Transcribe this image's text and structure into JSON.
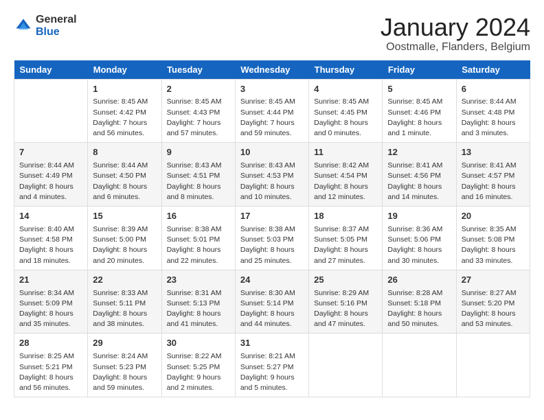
{
  "header": {
    "logo_general": "General",
    "logo_blue": "Blue",
    "month_title": "January 2024",
    "location": "Oostmalle, Flanders, Belgium"
  },
  "days_of_week": [
    "Sunday",
    "Monday",
    "Tuesday",
    "Wednesday",
    "Thursday",
    "Friday",
    "Saturday"
  ],
  "weeks": [
    [
      {
        "day": "",
        "details": ""
      },
      {
        "day": "1",
        "details": "Sunrise: 8:45 AM\nSunset: 4:42 PM\nDaylight: 7 hours\nand 56 minutes."
      },
      {
        "day": "2",
        "details": "Sunrise: 8:45 AM\nSunset: 4:43 PM\nDaylight: 7 hours\nand 57 minutes."
      },
      {
        "day": "3",
        "details": "Sunrise: 8:45 AM\nSunset: 4:44 PM\nDaylight: 7 hours\nand 59 minutes."
      },
      {
        "day": "4",
        "details": "Sunrise: 8:45 AM\nSunset: 4:45 PM\nDaylight: 8 hours\nand 0 minutes."
      },
      {
        "day": "5",
        "details": "Sunrise: 8:45 AM\nSunset: 4:46 PM\nDaylight: 8 hours\nand 1 minute."
      },
      {
        "day": "6",
        "details": "Sunrise: 8:44 AM\nSunset: 4:48 PM\nDaylight: 8 hours\nand 3 minutes."
      }
    ],
    [
      {
        "day": "7",
        "details": "Sunrise: 8:44 AM\nSunset: 4:49 PM\nDaylight: 8 hours\nand 4 minutes."
      },
      {
        "day": "8",
        "details": "Sunrise: 8:44 AM\nSunset: 4:50 PM\nDaylight: 8 hours\nand 6 minutes."
      },
      {
        "day": "9",
        "details": "Sunrise: 8:43 AM\nSunset: 4:51 PM\nDaylight: 8 hours\nand 8 minutes."
      },
      {
        "day": "10",
        "details": "Sunrise: 8:43 AM\nSunset: 4:53 PM\nDaylight: 8 hours\nand 10 minutes."
      },
      {
        "day": "11",
        "details": "Sunrise: 8:42 AM\nSunset: 4:54 PM\nDaylight: 8 hours\nand 12 minutes."
      },
      {
        "day": "12",
        "details": "Sunrise: 8:41 AM\nSunset: 4:56 PM\nDaylight: 8 hours\nand 14 minutes."
      },
      {
        "day": "13",
        "details": "Sunrise: 8:41 AM\nSunset: 4:57 PM\nDaylight: 8 hours\nand 16 minutes."
      }
    ],
    [
      {
        "day": "14",
        "details": "Sunrise: 8:40 AM\nSunset: 4:58 PM\nDaylight: 8 hours\nand 18 minutes."
      },
      {
        "day": "15",
        "details": "Sunrise: 8:39 AM\nSunset: 5:00 PM\nDaylight: 8 hours\nand 20 minutes."
      },
      {
        "day": "16",
        "details": "Sunrise: 8:38 AM\nSunset: 5:01 PM\nDaylight: 8 hours\nand 22 minutes."
      },
      {
        "day": "17",
        "details": "Sunrise: 8:38 AM\nSunset: 5:03 PM\nDaylight: 8 hours\nand 25 minutes."
      },
      {
        "day": "18",
        "details": "Sunrise: 8:37 AM\nSunset: 5:05 PM\nDaylight: 8 hours\nand 27 minutes."
      },
      {
        "day": "19",
        "details": "Sunrise: 8:36 AM\nSunset: 5:06 PM\nDaylight: 8 hours\nand 30 minutes."
      },
      {
        "day": "20",
        "details": "Sunrise: 8:35 AM\nSunset: 5:08 PM\nDaylight: 8 hours\nand 33 minutes."
      }
    ],
    [
      {
        "day": "21",
        "details": "Sunrise: 8:34 AM\nSunset: 5:09 PM\nDaylight: 8 hours\nand 35 minutes."
      },
      {
        "day": "22",
        "details": "Sunrise: 8:33 AM\nSunset: 5:11 PM\nDaylight: 8 hours\nand 38 minutes."
      },
      {
        "day": "23",
        "details": "Sunrise: 8:31 AM\nSunset: 5:13 PM\nDaylight: 8 hours\nand 41 minutes."
      },
      {
        "day": "24",
        "details": "Sunrise: 8:30 AM\nSunset: 5:14 PM\nDaylight: 8 hours\nand 44 minutes."
      },
      {
        "day": "25",
        "details": "Sunrise: 8:29 AM\nSunset: 5:16 PM\nDaylight: 8 hours\nand 47 minutes."
      },
      {
        "day": "26",
        "details": "Sunrise: 8:28 AM\nSunset: 5:18 PM\nDaylight: 8 hours\nand 50 minutes."
      },
      {
        "day": "27",
        "details": "Sunrise: 8:27 AM\nSunset: 5:20 PM\nDaylight: 8 hours\nand 53 minutes."
      }
    ],
    [
      {
        "day": "28",
        "details": "Sunrise: 8:25 AM\nSunset: 5:21 PM\nDaylight: 8 hours\nand 56 minutes."
      },
      {
        "day": "29",
        "details": "Sunrise: 8:24 AM\nSunset: 5:23 PM\nDaylight: 8 hours\nand 59 minutes."
      },
      {
        "day": "30",
        "details": "Sunrise: 8:22 AM\nSunset: 5:25 PM\nDaylight: 9 hours\nand 2 minutes."
      },
      {
        "day": "31",
        "details": "Sunrise: 8:21 AM\nSunset: 5:27 PM\nDaylight: 9 hours\nand 5 minutes."
      },
      {
        "day": "",
        "details": ""
      },
      {
        "day": "",
        "details": ""
      },
      {
        "day": "",
        "details": ""
      }
    ]
  ]
}
